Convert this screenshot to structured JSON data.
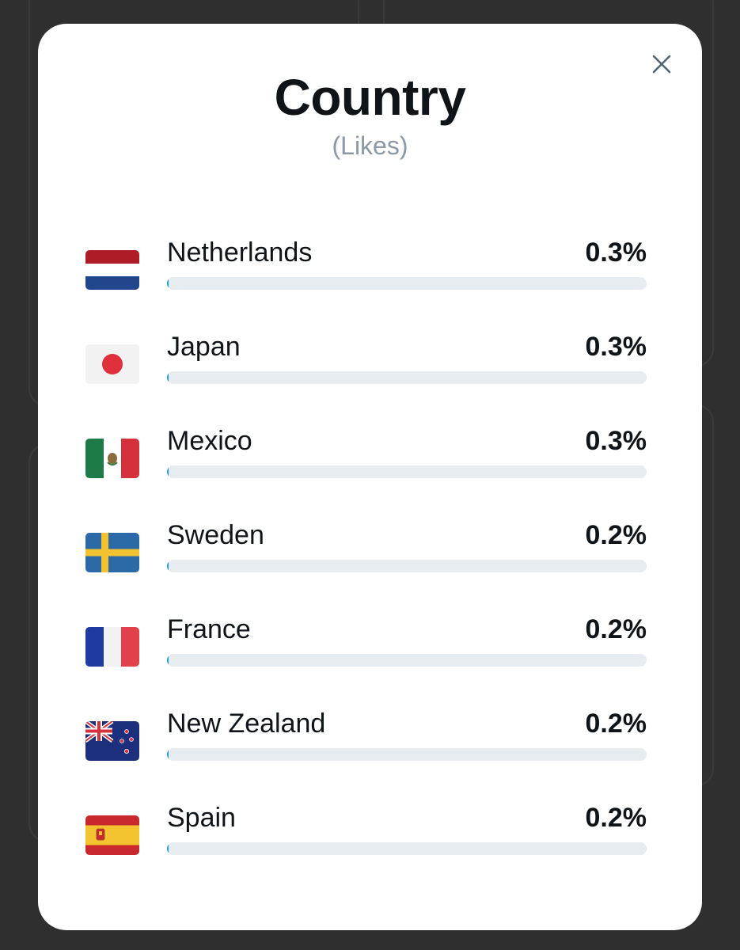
{
  "modal": {
    "title": "Country",
    "subtitle": "(Likes)",
    "close_icon": "close-icon"
  },
  "countries": [
    {
      "name": "Netherlands",
      "value": "0.3%",
      "fraction": 0.003,
      "flag": "netherlands-flag-icon"
    },
    {
      "name": "Japan",
      "value": "0.3%",
      "fraction": 0.003,
      "flag": "japan-flag-icon"
    },
    {
      "name": "Mexico",
      "value": "0.3%",
      "fraction": 0.003,
      "flag": "mexico-flag-icon"
    },
    {
      "name": "Sweden",
      "value": "0.2%",
      "fraction": 0.002,
      "flag": "sweden-flag-icon"
    },
    {
      "name": "France",
      "value": "0.2%",
      "fraction": 0.002,
      "flag": "france-flag-icon"
    },
    {
      "name": "New Zealand",
      "value": "0.2%",
      "fraction": 0.002,
      "flag": "new-zealand-flag-icon"
    },
    {
      "name": "Spain",
      "value": "0.2%",
      "fraction": 0.002,
      "flag": "spain-flag-icon"
    }
  ],
  "colors": {
    "bar_fill": "#1d9bf0",
    "bar_track": "#e7ecf0",
    "subtitle": "#8b98a5"
  }
}
